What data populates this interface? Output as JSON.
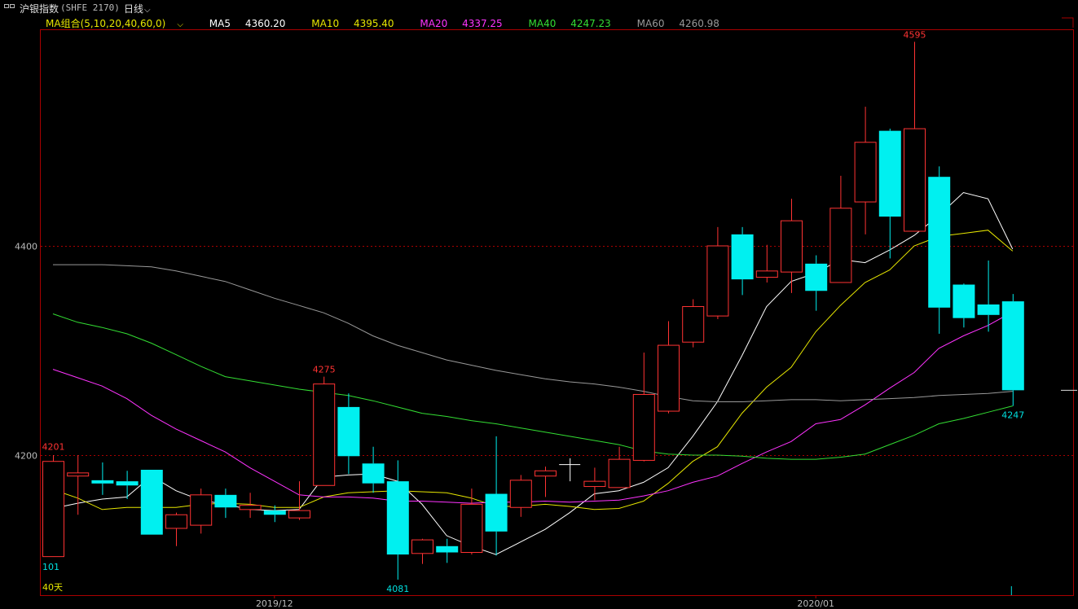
{
  "header": {
    "window_icon": "split-window-icon",
    "title": "沪银指数",
    "code": "(SHFE 2170)",
    "period": "日线",
    "period_icon": "chevron-down-icon"
  },
  "legend": {
    "group_label": "MA组合(5,10,20,40,60,0)",
    "group_icon": "chevron-down-icon",
    "items": [
      {
        "name": "MA5",
        "value": "4360.20",
        "color": "#ffffff"
      },
      {
        "name": "MA10",
        "value": "4395.40",
        "color": "#e6e600"
      },
      {
        "name": "MA20",
        "value": "4337.25",
        "color": "#ff33ff"
      },
      {
        "name": "MA40",
        "value": "4247.23",
        "color": "#33dd33"
      },
      {
        "name": "MA60",
        "value": "4260.98",
        "color": "#999999"
      }
    ]
  },
  "colors": {
    "up": "#ff3333",
    "down": "#00f0f0",
    "grid": "#aa0000",
    "axis": "#aa0000"
  },
  "chart_data": {
    "type": "candlestick",
    "y_ticks": [
      4200,
      4400
    ],
    "ylim": [
      4060,
      4630
    ],
    "x_ticks": [
      {
        "index": 9,
        "label": "2019/12"
      },
      {
        "index": 31,
        "label": "2020/01"
      }
    ],
    "annotations": [
      {
        "index": 0,
        "text": "4201",
        "value": 4201,
        "kind": "high",
        "color": "#ff3333"
      },
      {
        "index": 11,
        "text": "4275",
        "value": 4275,
        "kind": "high",
        "color": "#ff3333"
      },
      {
        "index": 14,
        "text": "4081",
        "value": 4081,
        "kind": "low",
        "color": "#00e0e0"
      },
      {
        "index": 35,
        "text": "4595",
        "value": 4595,
        "kind": "high",
        "color": "#ff3333"
      },
      {
        "index": 39,
        "text": "4247",
        "value": 4247,
        "kind": "low",
        "color": "#00e0e0"
      }
    ],
    "corner_labels": {
      "left_value": "101",
      "range": "40天"
    },
    "last_price": 4262,
    "candles": [
      {
        "o": 4103,
        "h": 4200,
        "l": 4103,
        "c": 4194
      },
      {
        "o": 4180,
        "h": 4200,
        "l": 4143,
        "c": 4183
      },
      {
        "o": 4176,
        "h": 4193,
        "l": 4162,
        "c": 4173
      },
      {
        "o": 4175,
        "h": 4185,
        "l": 4158,
        "c": 4171
      },
      {
        "o": 4186,
        "h": 4186,
        "l": 4124,
        "c": 4124
      },
      {
        "o": 4130,
        "h": 4145,
        "l": 4113,
        "c": 4143
      },
      {
        "o": 4133,
        "h": 4168,
        "l": 4125,
        "c": 4162
      },
      {
        "o": 4162,
        "h": 4168,
        "l": 4140,
        "c": 4150
      },
      {
        "o": 4148,
        "h": 4164,
        "l": 4140,
        "c": 4152
      },
      {
        "o": 4147,
        "h": 4152,
        "l": 4136,
        "c": 4143
      },
      {
        "o": 4140,
        "h": 4175,
        "l": 4138,
        "c": 4147
      },
      {
        "o": 4171,
        "h": 4275,
        "l": 4171,
        "c": 4268
      },
      {
        "o": 4246,
        "h": 4259,
        "l": 4182,
        "c": 4199
      },
      {
        "o": 4192,
        "h": 4208,
        "l": 4164,
        "c": 4173
      },
      {
        "o": 4175,
        "h": 4195,
        "l": 4081,
        "c": 4105
      },
      {
        "o": 4106,
        "h": 4120,
        "l": 4096,
        "c": 4119
      },
      {
        "o": 4113,
        "h": 4120,
        "l": 4097,
        "c": 4107
      },
      {
        "o": 4107,
        "h": 4168,
        "l": 4105,
        "c": 4153
      },
      {
        "o": 4163,
        "h": 4218,
        "l": 4104,
        "c": 4127
      },
      {
        "o": 4150,
        "h": 4181,
        "l": 4141,
        "c": 4176
      },
      {
        "o": 4180,
        "h": 4189,
        "l": 4160,
        "c": 4185
      },
      {
        "o": 4191,
        "h": 4197,
        "l": 4175,
        "c": 4191
      },
      {
        "o": 4170,
        "h": 4188,
        "l": 4157,
        "c": 4175
      },
      {
        "o": 4169,
        "h": 4208,
        "l": 4169,
        "c": 4196
      },
      {
        "o": 4195,
        "h": 4298,
        "l": 4194,
        "c": 4258
      },
      {
        "o": 4242,
        "h": 4328,
        "l": 4240,
        "c": 4305
      },
      {
        "o": 4308,
        "h": 4349,
        "l": 4303,
        "c": 4342
      },
      {
        "o": 4333,
        "h": 4418,
        "l": 4330,
        "c": 4400
      },
      {
        "o": 4411,
        "h": 4418,
        "l": 4353,
        "c": 4368
      },
      {
        "o": 4370,
        "h": 4401,
        "l": 4365,
        "c": 4376
      },
      {
        "o": 4375,
        "h": 4445,
        "l": 4355,
        "c": 4424
      },
      {
        "o": 4383,
        "h": 4391,
        "l": 4338,
        "c": 4357
      },
      {
        "o": 4365,
        "h": 4467,
        "l": 4365,
        "c": 4436
      },
      {
        "o": 4442,
        "h": 4533,
        "l": 4411,
        "c": 4499
      },
      {
        "o": 4510,
        "h": 4512,
        "l": 4388,
        "c": 4428
      },
      {
        "o": 4414,
        "h": 4595,
        "l": 4414,
        "c": 4512
      },
      {
        "o": 4466,
        "h": 4476,
        "l": 4316,
        "c": 4341
      },
      {
        "o": 4363,
        "h": 4364,
        "l": 4322,
        "c": 4331
      },
      {
        "o": 4344,
        "h": 4386,
        "l": 4318,
        "c": 4334
      },
      {
        "o": 4347,
        "h": 4354,
        "l": 4247,
        "c": 4262
      }
    ],
    "series": [
      {
        "name": "MA5",
        "color": "#ffffff",
        "values": [
          4149,
          4154,
          4158,
          4160,
          4180,
          4166,
          4157,
          4153,
          4148,
          4147,
          4148,
          4179,
          4181,
          4182,
          4175,
          4153,
          4123,
          4113,
          4105,
          4117,
          4129,
          4145,
          4163,
          4166,
          4174,
          4188,
          4218,
          4251,
          4295,
          4342,
          4366,
          4374,
          4387,
          4384,
          4396,
          4410,
          4429,
          4451,
          4445,
          4397
        ]
      },
      {
        "name": "MA10",
        "color": "#e6e600",
        "values": [
          4167,
          4159,
          4148,
          4150,
          4150,
          4150,
          4153,
          4154,
          4153,
          4150,
          4150,
          4160,
          4164,
          4165,
          4166,
          4165,
          4164,
          4159,
          4151,
          4151,
          4153,
          4151,
          4148,
          4149,
          4156,
          4173,
          4194,
          4208,
          4240,
          4265,
          4284,
          4318,
          4343,
          4365,
          4377,
          4400,
          4409,
          4412,
          4415,
          4395
        ]
      },
      {
        "name": "MA20",
        "color": "#ff33ff",
        "values": [
          4282,
          4274,
          4266,
          4254,
          4238,
          4225,
          4214,
          4203,
          4188,
          4175,
          4162,
          4160,
          4160,
          4159,
          4156,
          4156,
          4155,
          4154,
          4155,
          4155,
          4156,
          4155,
          4156,
          4157,
          4161,
          4166,
          4174,
          4180,
          4192,
          4203,
          4213,
          4230,
          4234,
          4248,
          4264,
          4279,
          4302,
          4314,
          4324,
          4337
        ]
      },
      {
        "name": "MA40",
        "color": "#33dd33",
        "values": [
          4335,
          4327,
          4322,
          4316,
          4307,
          4296,
          4285,
          4275,
          4271,
          4267,
          4263,
          4260,
          4257,
          4252,
          4246,
          4240,
          4237,
          4233,
          4230,
          4226,
          4222,
          4218,
          4214,
          4210,
          4204,
          4201,
          4200,
          4200,
          4199,
          4197,
          4196,
          4196,
          4198,
          4201,
          4210,
          4219,
          4230,
          4235,
          4241,
          4247
        ]
      },
      {
        "name": "MA60",
        "color": "#999999",
        "values": [
          4382,
          4382,
          4382,
          4381,
          4380,
          4376,
          4371,
          4366,
          4358,
          4350,
          4343,
          4336,
          4326,
          4314,
          4305,
          4298,
          4291,
          4286,
          4281,
          4277,
          4273,
          4270,
          4268,
          4265,
          4261,
          4256,
          4252,
          4251,
          4251,
          4252,
          4253,
          4253,
          4252,
          4253,
          4254,
          4255,
          4257,
          4258,
          4259,
          4261
        ]
      }
    ]
  }
}
